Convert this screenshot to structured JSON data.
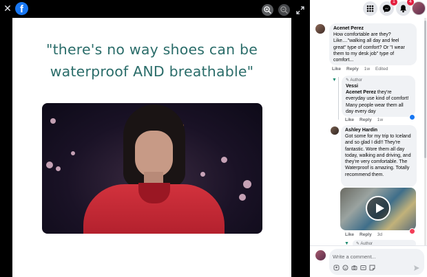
{
  "viewer": {
    "close_glyph": "✕",
    "logo_letter": "f",
    "meme_line1": "\"there's no way shoes can be",
    "meme_line2": "waterproof AND breathable\""
  },
  "topbar": {
    "messenger_badge": "1",
    "notifications_badge": "4"
  },
  "comments": [
    {
      "name": "Acenet Perez",
      "text": "How comfortable are they? Like....\"walking all day and feel great\" type of comfort? Or \"I wear them to my desk job\" type of comfort...",
      "like": "Like",
      "reply": "Reply",
      "time": "1w",
      "edited": "Edited"
    },
    {
      "author_tag": "Author",
      "name": "Vessi",
      "mention": "Acenet Perez",
      "text": " they're everyday use kind of comfort! Many people wear them all day every day",
      "like": "Like",
      "reply": "Reply",
      "time": "1w"
    },
    {
      "name": "Ashley Hardin",
      "text": "Got some for my trip to Iceland and so glad I did!! They're fantastic. Wore them all day today, walking and driving, and they're very comfortable. The Waterproof is amazing. Totally recommend them.",
      "like": "Like",
      "reply": "Reply",
      "time": "3d"
    },
    {
      "author_tag": "Author"
    }
  ],
  "composer": {
    "placeholder": "Write a comment..."
  },
  "icons": {
    "close": "close-icon",
    "zoom_in": "zoom-in-icon",
    "zoom_out": "zoom-out-icon",
    "expand": "expand-icon",
    "menu": "grid-menu-icon",
    "messenger": "messenger-icon",
    "notifications": "bell-icon",
    "send": "send-icon"
  },
  "colors": {
    "facebook_blue": "#1877f2",
    "meme_text": "#2b6d6a",
    "badge_red": "#e41e3f"
  }
}
